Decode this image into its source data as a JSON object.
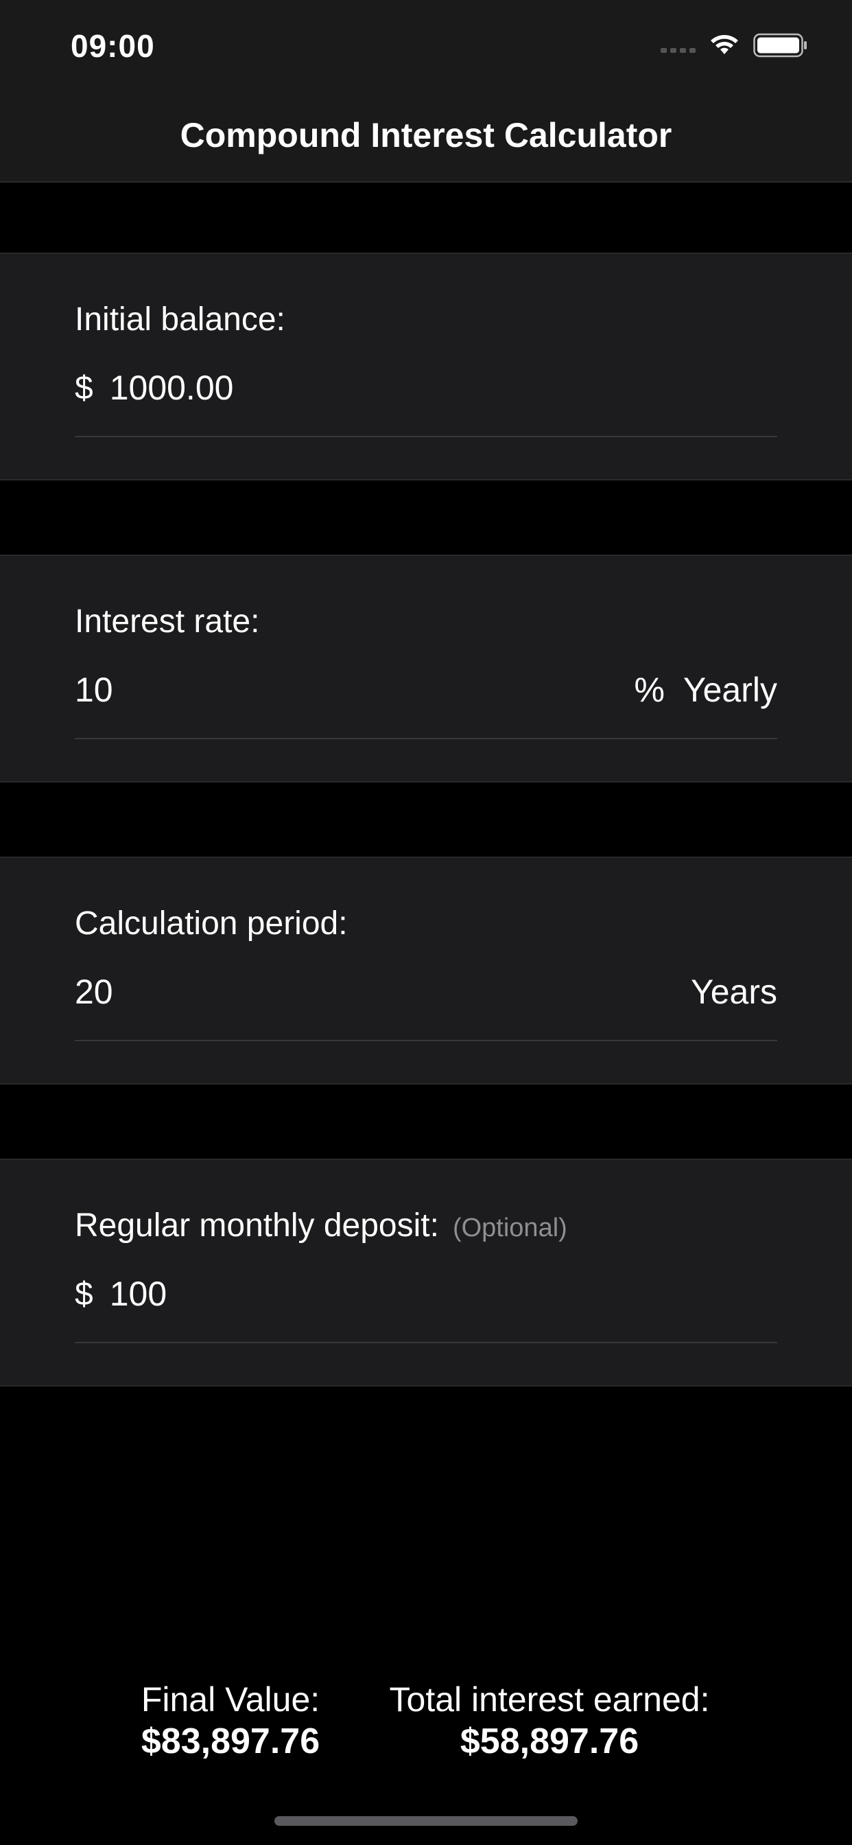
{
  "status_bar": {
    "time": "09:00",
    "icons": [
      "signal-icon",
      "wifi-icon",
      "battery-icon"
    ]
  },
  "nav": {
    "title": "Compound Interest Calculator"
  },
  "fields": {
    "initial_balance": {
      "label": "Initial balance:",
      "prefix": "$",
      "value": "1000.00"
    },
    "interest_rate": {
      "label": "Interest rate:",
      "value": "10",
      "suffix": "%  Yearly"
    },
    "calculation_period": {
      "label": "Calculation period:",
      "value": "20",
      "suffix": "Years"
    },
    "monthly_deposit": {
      "label": "Regular monthly deposit:",
      "optional": "(Optional)",
      "prefix": "$",
      "value": "100"
    }
  },
  "results": {
    "final_value_label": "Final Value:",
    "final_value": "$83,897.76",
    "total_interest_label": "Total interest earned:",
    "total_interest": "$58,897.76"
  },
  "colors": {
    "background": "#000000",
    "bar": "#1a1a1a",
    "section": "#1c1c1e",
    "text": "#ffffff",
    "secondary_text": "#8e8e93"
  }
}
